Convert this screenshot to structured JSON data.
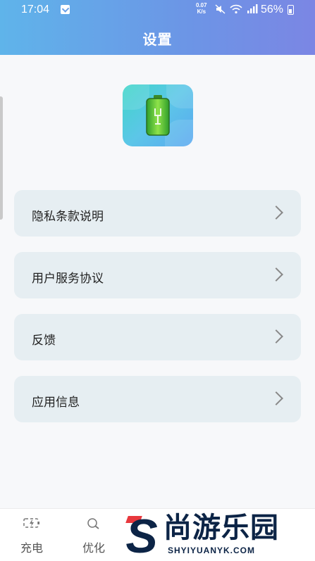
{
  "status_bar": {
    "time": "17:04",
    "net_speed_value": "0.07",
    "net_speed_unit": "K/s",
    "battery_percent": "56%"
  },
  "header": {
    "title": "设置"
  },
  "menu": {
    "items": [
      {
        "label": "隐私条款说明"
      },
      {
        "label": "用户服务协议"
      },
      {
        "label": "反馈"
      },
      {
        "label": "应用信息"
      }
    ]
  },
  "bottom_nav": {
    "tabs": [
      {
        "label": "充电",
        "icon": "charge-icon"
      },
      {
        "label": "优化",
        "icon": "optimize-icon"
      }
    ]
  },
  "watermark": {
    "logo_letter": "S",
    "text": "尚游乐园",
    "url": "SHYIYUANYK.COM"
  },
  "colors": {
    "header_start": "#5fb4ea",
    "header_end": "#7b86e4",
    "menu_bg": "#e6eef2",
    "watermark": "#0c2446",
    "watermark_accent": "#e8383d"
  }
}
